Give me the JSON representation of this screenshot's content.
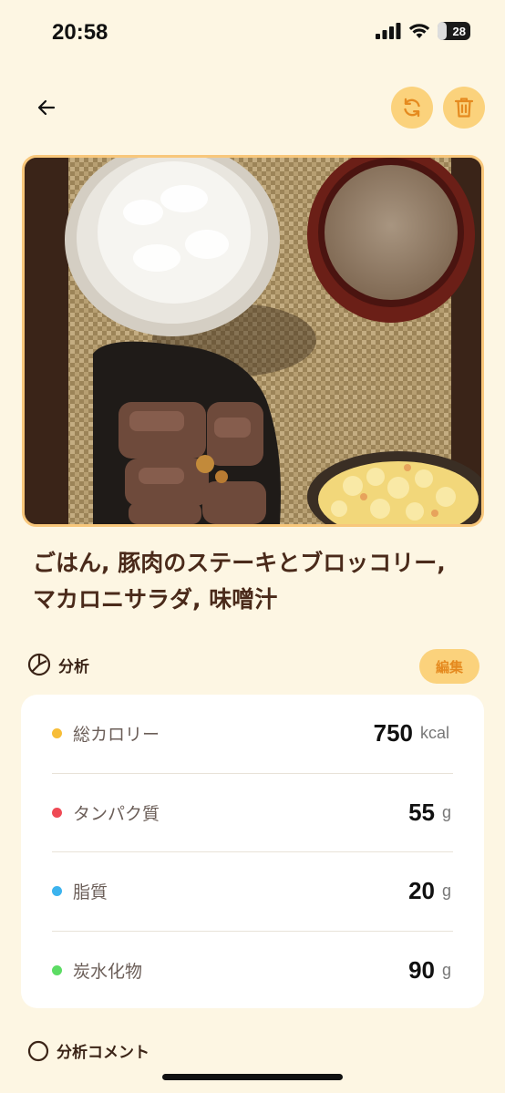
{
  "status_bar": {
    "time": "20:58",
    "battery": "28",
    "battery_level": 0.28
  },
  "header": {
    "back_icon": "arrow-left-icon",
    "refresh_icon": "refresh-icon",
    "delete_icon": "trash-icon"
  },
  "meal": {
    "title_line1": "ごはん, 豚肉のステーキとブロッコリー,",
    "title_line2": "マカロニサラダ, 味噌汁"
  },
  "analysis": {
    "header": "分析",
    "icon": "chart-pie-icon",
    "edit_label": "編集",
    "items": [
      {
        "label": "総カロリー",
        "value": "750",
        "unit": "kcal",
        "color": "#f7bd38"
      },
      {
        "label": "タンパク質",
        "value": "55",
        "unit": "g",
        "color": "#ef4a55"
      },
      {
        "label": "脂質",
        "value": "20",
        "unit": "g",
        "color": "#3cb3ee"
      },
      {
        "label": "炭水化物",
        "value": "90",
        "unit": "g",
        "color": "#5cdc64"
      }
    ]
  },
  "comment": {
    "header": "分析コメント"
  },
  "colors": {
    "accent": "#fbd27c",
    "accent_text": "#e58a1f",
    "background": "#fdf6e3"
  }
}
